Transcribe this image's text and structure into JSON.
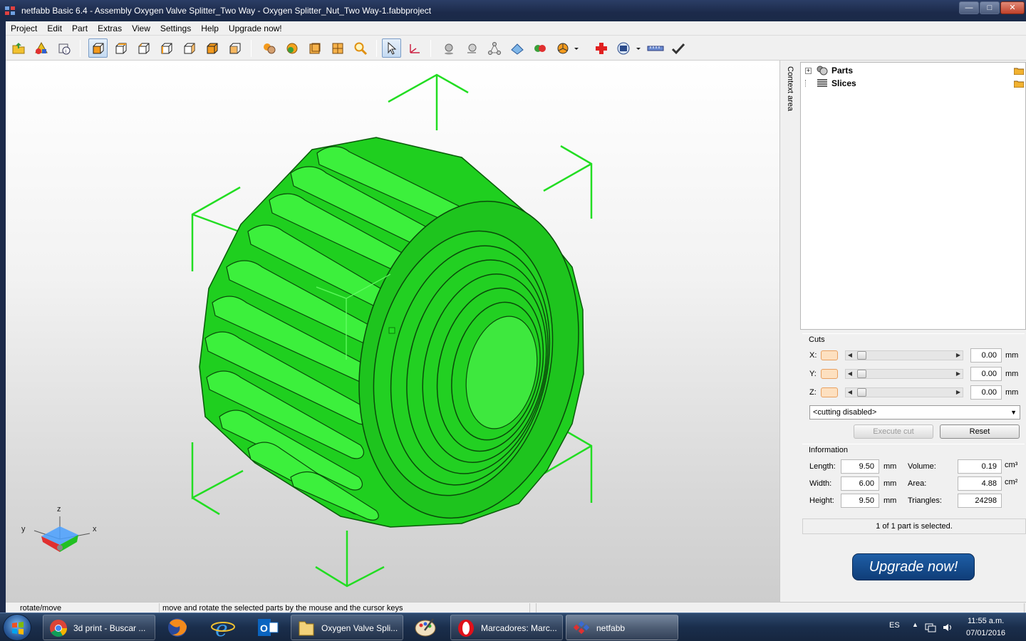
{
  "window": {
    "title": "netfabb Basic 6.4 - Assembly Oxygen Valve Splitter_Two Way - Oxygen Splitter_Nut_Two Way-1.fabbproject",
    "minimize": "—",
    "maximize": "□",
    "close": "✕"
  },
  "menu": [
    "Project",
    "Edit",
    "Part",
    "Extras",
    "View",
    "Settings",
    "Help",
    "Upgrade now!"
  ],
  "toolbar": {
    "icons": [
      "open-project-icon",
      "add-part-icon",
      "part-info-icon",
      "view-default-icon",
      "view-front-icon",
      "view-back-icon",
      "view-left-icon",
      "view-right-icon",
      "view-top-icon",
      "view-bottom-icon",
      "shaded-spheres-icon",
      "sphere-icon",
      "wireframe-box-icon",
      "mesh-box-icon",
      "zoom-icon",
      "select-pointer-icon",
      "axis-move-icon",
      "point-icon",
      "sphere-shadow-icon",
      "triangle-nodes-icon",
      "plane-icon",
      "color-spheres-icon",
      "pie-icon",
      "repair-cross-icon",
      "disk-icon",
      "ruler-icon",
      "checkmark-icon"
    ]
  },
  "viewport": {
    "axis_labels": {
      "x": "x",
      "y": "y",
      "z": "z"
    },
    "part_color": "#22dd22"
  },
  "context_tab": "Context area",
  "tree": [
    {
      "label": "Parts"
    },
    {
      "label": "Slices"
    }
  ],
  "cuts": {
    "title": "Cuts",
    "rows": [
      {
        "axis": "X:",
        "value": "0.00",
        "unit": "mm"
      },
      {
        "axis": "Y:",
        "value": "0.00",
        "unit": "mm"
      },
      {
        "axis": "Z:",
        "value": "0.00",
        "unit": "mm"
      }
    ],
    "mode": "<cutting disabled>",
    "execute": "Execute cut",
    "reset": "Reset"
  },
  "information": {
    "title": "Information",
    "length_label": "Length:",
    "length": "9.50",
    "length_unit": "mm",
    "width_label": "Width:",
    "width": "6.00",
    "width_unit": "mm",
    "height_label": "Height:",
    "height": "9.50",
    "height_unit": "mm",
    "volume_label": "Volume:",
    "volume": "0.19",
    "volume_unit": "cm³",
    "area_label": "Area:",
    "area": "4.88",
    "area_unit": "cm²",
    "triangles_label": "Triangles:",
    "triangles": "24298"
  },
  "selection_info": "1 of 1 part is selected.",
  "upgrade_button": "Upgrade now!",
  "statusbar": {
    "mode": "rotate/move",
    "hint": "move and rotate the selected parts by the mouse and the cursor keys"
  },
  "taskbar": {
    "tasks": [
      {
        "label": "3d print - Buscar ...",
        "icon": "chrome-icon"
      },
      {
        "label": "Oxygen Valve Spli...",
        "icon": "folder-icon"
      },
      {
        "label": "Marcadores: Marc...",
        "icon": "opera-icon"
      },
      {
        "label": "netfabb",
        "icon": "netfabb-icon"
      }
    ],
    "pinned": [
      "firefox-icon",
      "ie-icon",
      "outlook-icon",
      "paint-icon"
    ],
    "language": "ES",
    "time": "11:55 a.m.",
    "date": "07/01/2016"
  }
}
